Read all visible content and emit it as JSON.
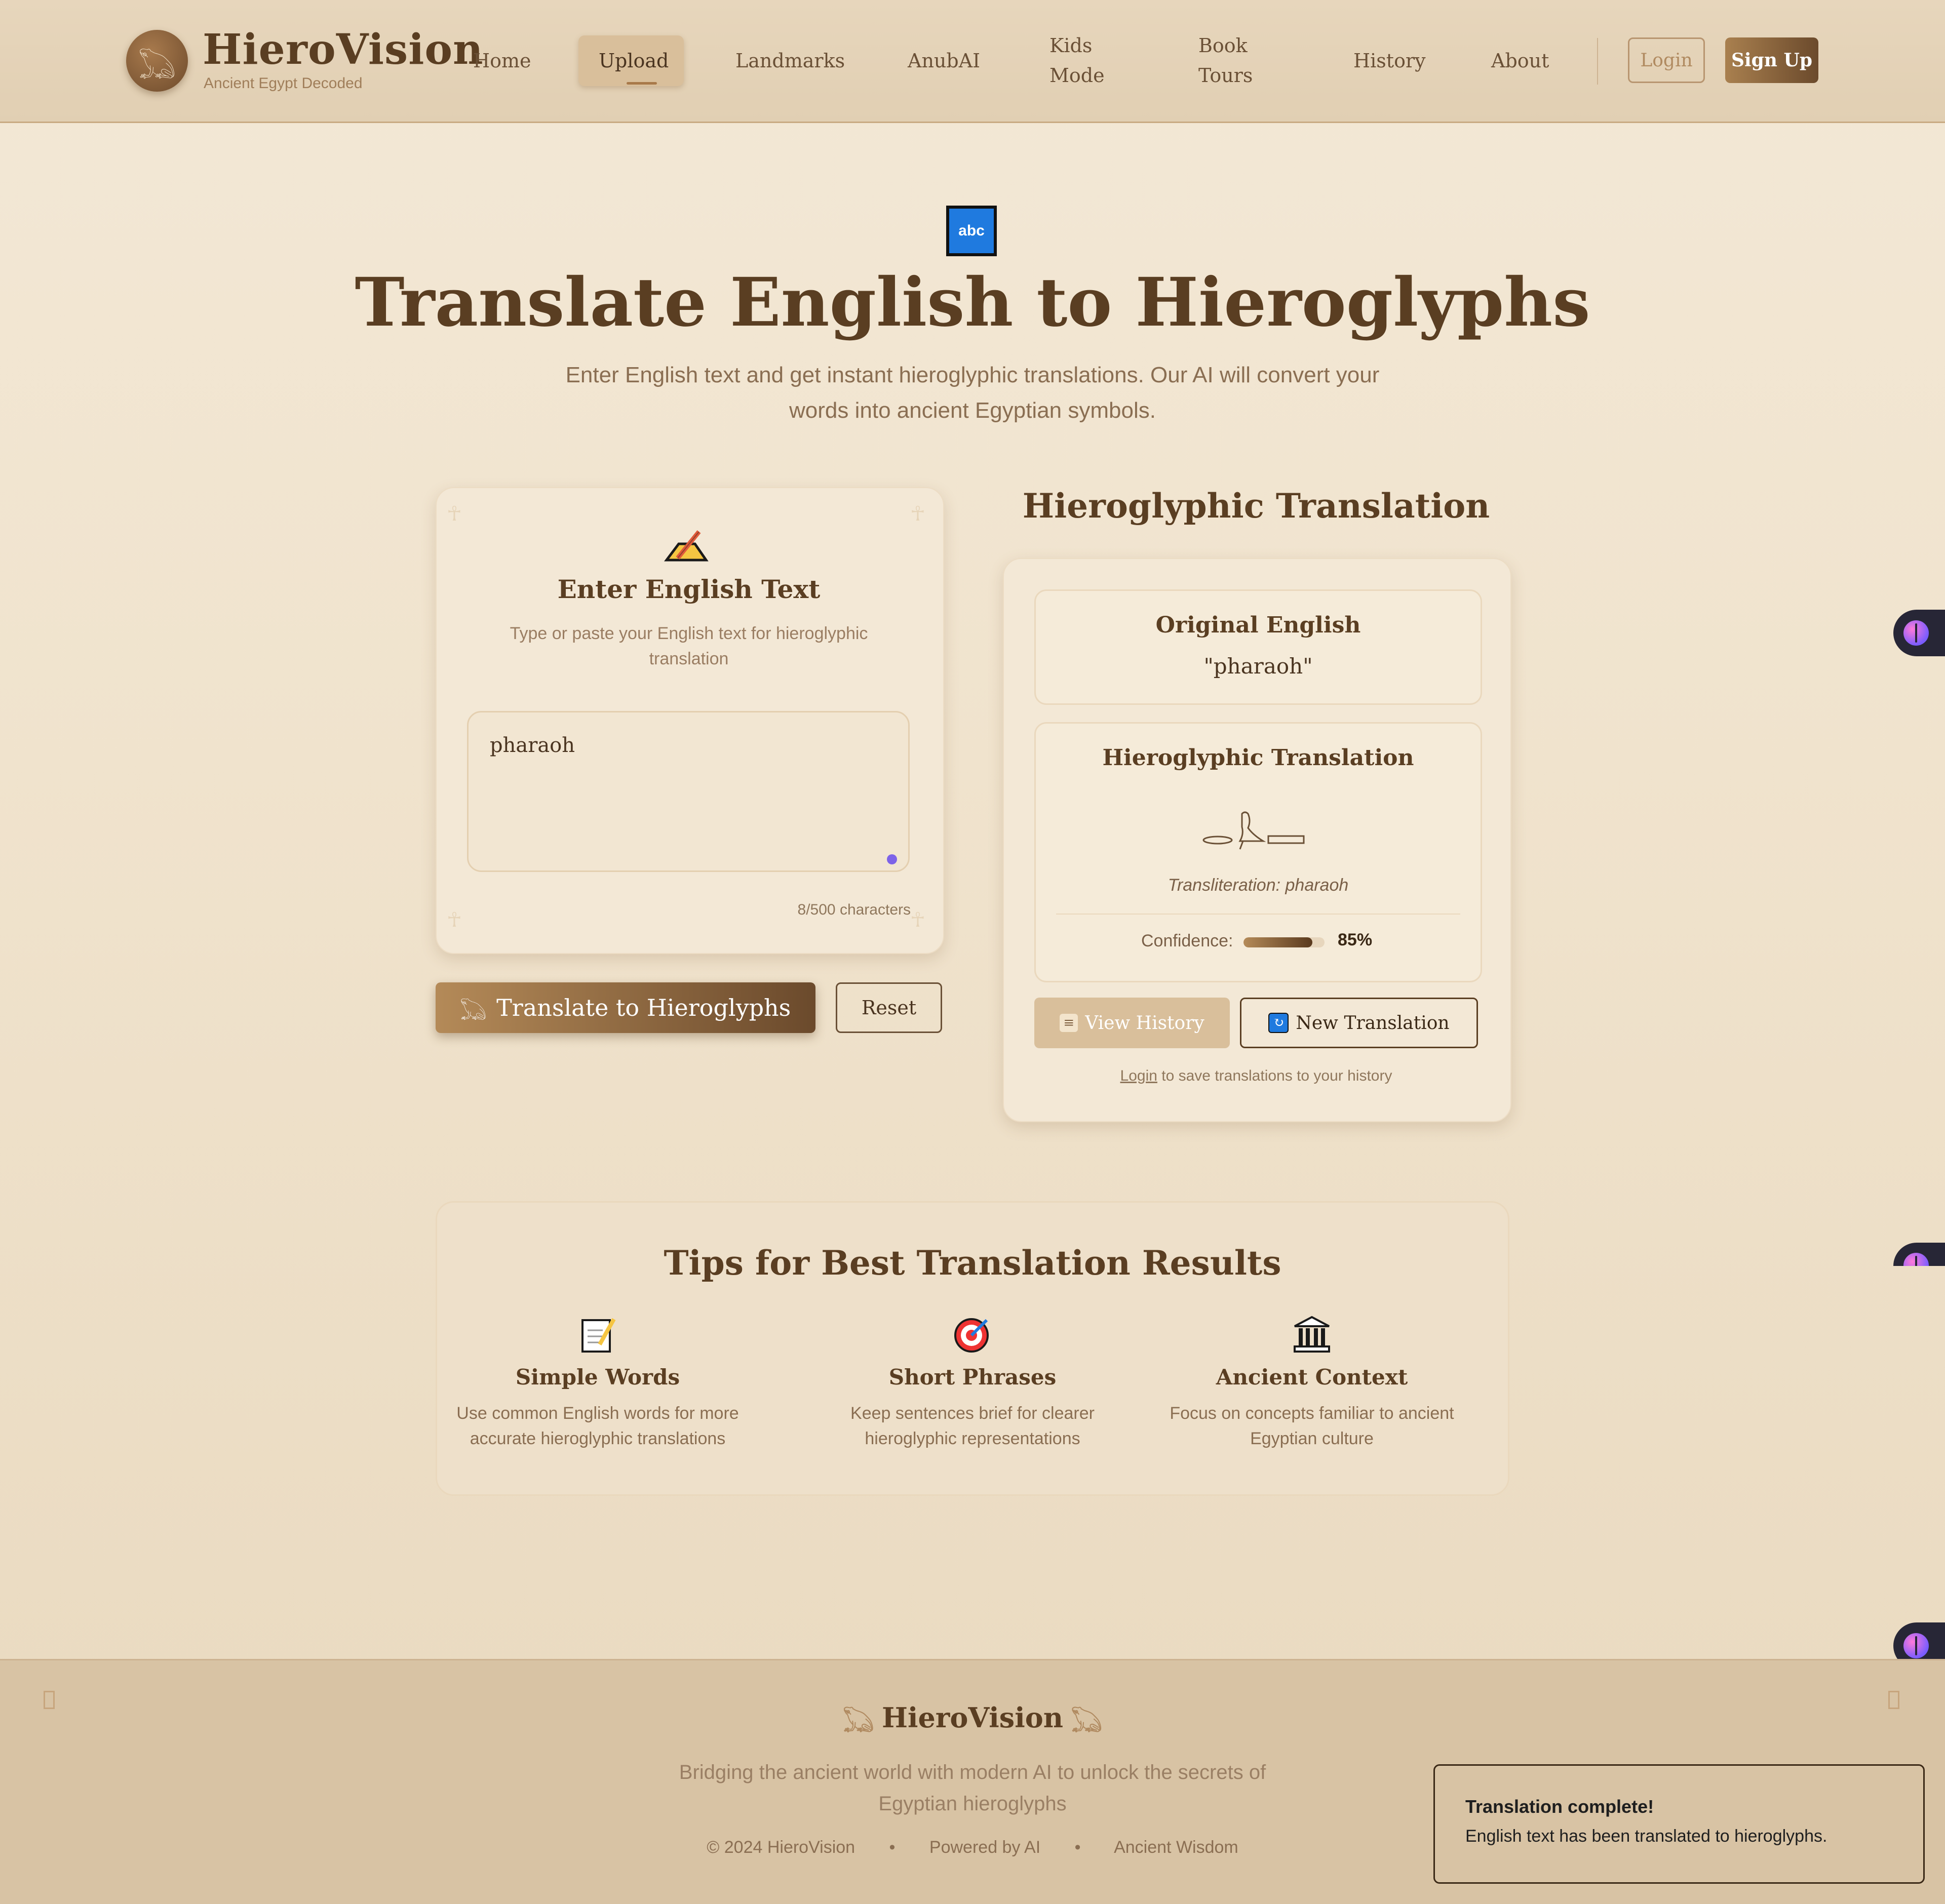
{
  "header": {
    "brand": "HieroVision",
    "tagline": "Ancient Egypt Decoded",
    "logo_icon": "eye-of-horus-icon",
    "nav": {
      "home": "Home",
      "upload": "Upload",
      "landmarks": "Landmarks",
      "anubai": "AnubAI",
      "kids_mode_1": "Kids",
      "kids_mode_2": "Mode",
      "book_tours_1": "Book",
      "book_tours_2": "Tours",
      "history": "History",
      "about": "About"
    },
    "active_nav": "Upload",
    "login": "Login",
    "signup": "Sign Up"
  },
  "hero": {
    "icon_label": "abc",
    "title": "Translate English to Hieroglyphs",
    "subtitle": "Enter English text and get instant hieroglyphic translations. Our AI will convert your words into ancient Egyptian symbols."
  },
  "input_card": {
    "icon": "writing-hand-icon",
    "title": "Enter English Text",
    "description": "Type or paste your English text for hieroglyphic translation",
    "text_value": "pharaoh",
    "char_count": "8/500 characters",
    "translate_button": "Translate to Hieroglyphs",
    "reset_button": "Reset"
  },
  "result": {
    "section_title": "Hieroglyphic Translation",
    "original_label": "Original English",
    "original_value": "\"pharaoh\"",
    "translation_label": "Hieroglyphic Translation",
    "transliteration": "Transliteration: pharaoh",
    "confidence_label": "Confidence:",
    "confidence_value": "85%",
    "confidence_fraction": 0.85,
    "view_history": "View History",
    "new_translation": "New Translation",
    "login_link": "Login",
    "login_note": "to save translations to your history"
  },
  "tips": {
    "title": "Tips for Best Translation Results",
    "items": [
      {
        "icon": "memo-icon",
        "title": "Simple Words",
        "desc": "Use common English words for more accurate hieroglyphic translations"
      },
      {
        "icon": "target-icon",
        "title": "Short Phrases",
        "desc": "Keep sentences brief for clearer hieroglyphic representations"
      },
      {
        "icon": "temple-icon",
        "title": "Ancient Context",
        "desc": "Focus on concepts familiar to ancient Egyptian culture"
      }
    ]
  },
  "footer": {
    "brand": "HieroVision",
    "description": "Bridging the ancient world with modern AI to unlock the secrets of Egyptian hieroglyphs",
    "copyright": "© 2024 HieroVision",
    "powered": "Powered by AI",
    "wisdom": "Ancient Wisdom",
    "separator": "•"
  },
  "toast": {
    "title": "Translation complete!",
    "body": "English text has been translated to hieroglyphs."
  },
  "colors": {
    "accent_brown": "#6b4a2c",
    "accent_tan": "#b48a58",
    "background": "#f3e8d6",
    "confidence_purple_dot": "#7d63e8"
  }
}
